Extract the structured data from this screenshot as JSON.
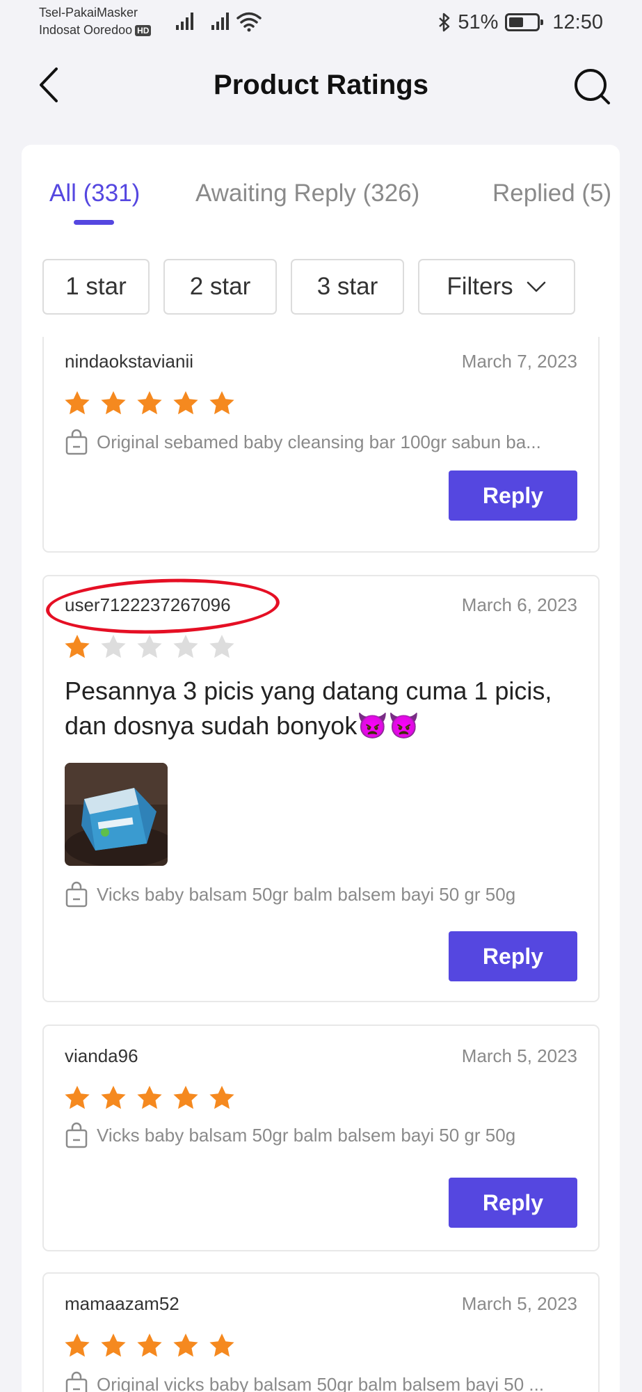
{
  "status_bar": {
    "carrier_line1": "Tsel-PakaiMasker",
    "carrier_line2": "Indosat Ooredoo",
    "hd_badge": "HD",
    "battery_text": "51%",
    "battery_level": 0.51,
    "time": "12:50",
    "icons": [
      "signal-icon",
      "signal-icon",
      "wifi-icon",
      "bluetooth-icon",
      "battery-icon"
    ]
  },
  "header": {
    "title": "Product Ratings",
    "icons": {
      "back": "back-arrow-icon",
      "search": "search-icon"
    }
  },
  "tabs": [
    {
      "label": "All (331)",
      "active": true
    },
    {
      "label": "Awaiting Reply (326)",
      "active": false
    },
    {
      "label": "Replied (5)",
      "active": false
    }
  ],
  "filters": [
    {
      "label": "1 star"
    },
    {
      "label": "2 star"
    },
    {
      "label": "3 star"
    },
    {
      "label": "Filters",
      "icon": "chevron-down-icon"
    }
  ],
  "colors": {
    "accent": "#5547e0",
    "star_filled": "#f5891f",
    "star_empty": "#dddddd",
    "highlight": "#e50f24"
  },
  "reviews": [
    {
      "username": "nindaokstavianii",
      "date": "March 7, 2023",
      "rating": 5,
      "product": "Original sebamed baby cleansing bar 100gr sabun ba...",
      "reply_label": "Reply"
    },
    {
      "username": "user7122237267096",
      "date": "March 6, 2023",
      "rating": 1,
      "text": "Pesannya 3 picis yang datang cuma 1 picis, dan dosnya sudah bonyok👿👿",
      "has_photo": true,
      "product": "Vicks baby balsam 50gr balm balsem bayi 50 gr 50g",
      "reply_label": "Reply",
      "highlighted": true
    },
    {
      "username": "vianda96",
      "date": "March 5, 2023",
      "rating": 5,
      "product": "Vicks baby balsam 50gr balm balsem bayi 50 gr 50g",
      "reply_label": "Reply"
    },
    {
      "username": "mamaazam52",
      "date": "March 5, 2023",
      "rating": 5,
      "product": "Original vicks baby balsam 50gr balm balsem bayi 50 ..."
    }
  ]
}
